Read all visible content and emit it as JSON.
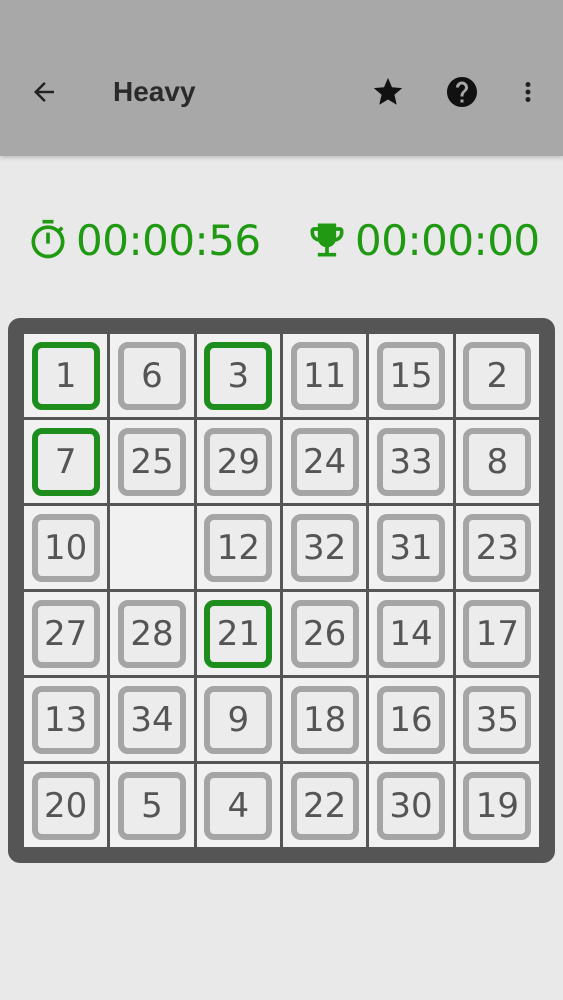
{
  "app_bar": {
    "title": "Heavy",
    "back_icon": "arrow-left-icon",
    "actions": [
      {
        "icon": "star-icon"
      },
      {
        "icon": "help-circle-icon"
      },
      {
        "icon": "more-vert-icon"
      }
    ]
  },
  "timers": {
    "elapsed": "00:00:56",
    "elapsed_icon": "stopwatch-icon",
    "best": "00:00:00",
    "best_icon": "trophy-icon"
  },
  "colors": {
    "app_bar": "#a8a8a8",
    "background": "#e9e9e9",
    "accent_green": "#1f9a12",
    "board": "#555555",
    "tile_border": "#a5a5a5",
    "tile_placed_border": "#1d8e1d",
    "tile_text": "#555555"
  },
  "board": {
    "rows": 6,
    "cols": 6,
    "tiles": [
      [
        {
          "n": "1",
          "placed": true
        },
        {
          "n": "6",
          "placed": false
        },
        {
          "n": "3",
          "placed": true
        },
        {
          "n": "11",
          "placed": false
        },
        {
          "n": "15",
          "placed": false
        },
        {
          "n": "2",
          "placed": false
        }
      ],
      [
        {
          "n": "7",
          "placed": true
        },
        {
          "n": "25",
          "placed": false
        },
        {
          "n": "29",
          "placed": false
        },
        {
          "n": "24",
          "placed": false
        },
        {
          "n": "33",
          "placed": false
        },
        {
          "n": "8",
          "placed": false
        }
      ],
      [
        {
          "n": "10",
          "placed": false
        },
        {
          "n": "",
          "placed": false,
          "empty": true
        },
        {
          "n": "12",
          "placed": false
        },
        {
          "n": "32",
          "placed": false
        },
        {
          "n": "31",
          "placed": false
        },
        {
          "n": "23",
          "placed": false
        }
      ],
      [
        {
          "n": "27",
          "placed": false
        },
        {
          "n": "28",
          "placed": false
        },
        {
          "n": "21",
          "placed": true
        },
        {
          "n": "26",
          "placed": false
        },
        {
          "n": "14",
          "placed": false
        },
        {
          "n": "17",
          "placed": false
        }
      ],
      [
        {
          "n": "13",
          "placed": false
        },
        {
          "n": "34",
          "placed": false
        },
        {
          "n": "9",
          "placed": false
        },
        {
          "n": "18",
          "placed": false
        },
        {
          "n": "16",
          "placed": false
        },
        {
          "n": "35",
          "placed": false
        }
      ],
      [
        {
          "n": "20",
          "placed": false
        },
        {
          "n": "5",
          "placed": false
        },
        {
          "n": "4",
          "placed": false
        },
        {
          "n": "22",
          "placed": false
        },
        {
          "n": "30",
          "placed": false
        },
        {
          "n": "19",
          "placed": false
        }
      ]
    ]
  }
}
